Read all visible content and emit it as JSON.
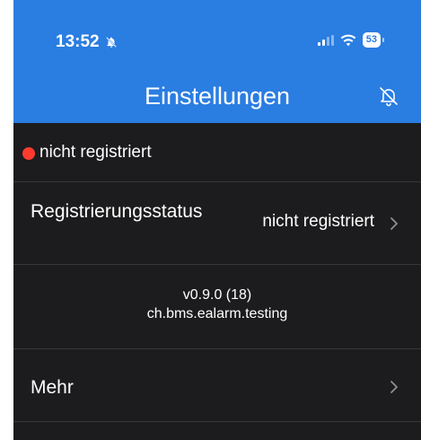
{
  "status_bar": {
    "time": "13:52",
    "battery": "53"
  },
  "header": {
    "title": "Einstellungen"
  },
  "registration_banner": {
    "text": "nicht registriert",
    "dot_color": "#ff3b30"
  },
  "registration_row": {
    "label": "Registrierungsstatus",
    "value": "nicht registriert"
  },
  "version": {
    "version_text": "v0.9.0 (18)",
    "bundle_id": "ch.bms.ealarm.testing"
  },
  "more_row": {
    "label": "Mehr"
  },
  "colors": {
    "header_bg": "#2a7de1",
    "content_bg": "#1c1c1e",
    "separator": "#38383a"
  },
  "icons": [
    "bell-slash-icon",
    "signal-icon",
    "wifi-icon",
    "battery-icon",
    "chevron-right-icon"
  ]
}
